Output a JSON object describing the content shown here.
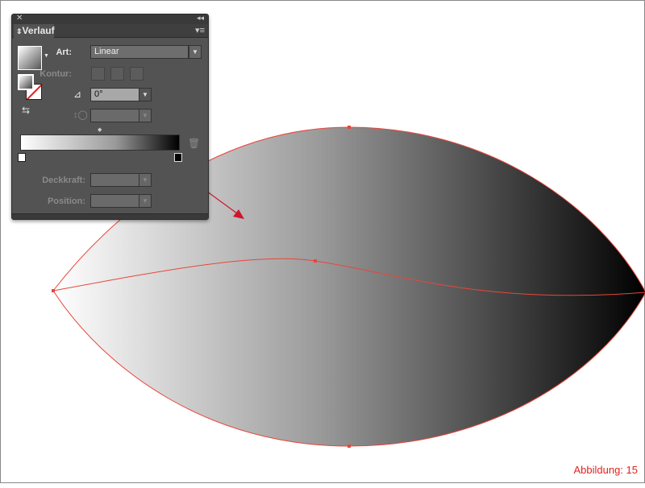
{
  "panel": {
    "title": "Verlauf",
    "type_label": "Art:",
    "type_value": "Linear",
    "stroke_label": "Kontur:",
    "angle_value": "0°",
    "opacity_label": "Deckkraft:",
    "position_label": "Position:"
  },
  "gradient": {
    "stops": [
      "#ffffff",
      "#000000"
    ]
  },
  "colors": {
    "path": "#e8463a",
    "arrow": "#d0142a",
    "caption": "#e0231f"
  },
  "caption": "Abbildung: 15"
}
